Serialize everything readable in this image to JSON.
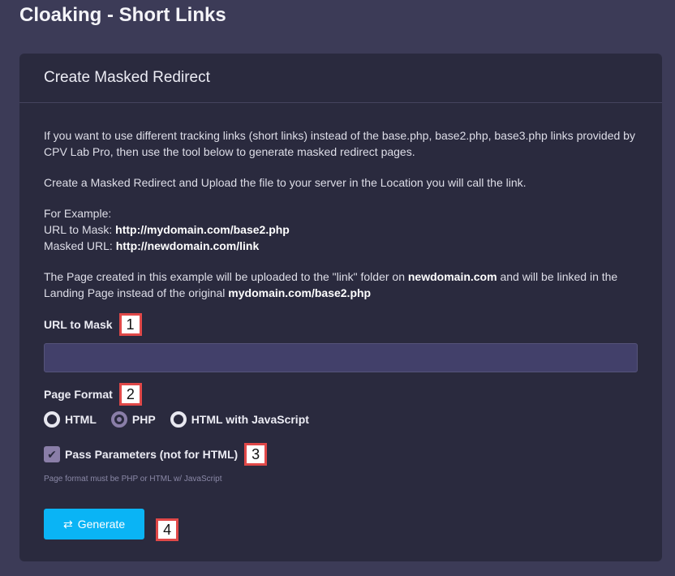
{
  "page": {
    "title": "Cloaking - Short Links"
  },
  "card": {
    "header": "Create Masked Redirect",
    "intro_part1": "If you want to use different tracking links (short links) instead of the base.php, base2.php, base3.php links provided by CPV Lab Pro, then use the tool below to generate masked redirect pages.",
    "intro_part2": "Create a Masked Redirect and Upload the file to your server in the Location you will call the link.",
    "example_heading": "For Example:",
    "example_url_label": "URL to Mask: ",
    "example_url_value": "http://mydomain.com/base2.php",
    "example_masked_label": "Masked URL: ",
    "example_masked_value": "http://newdomain.com/link",
    "explain_1": "The Page created in this example will be uploaded to the \"link\" folder on ",
    "explain_domain": "newdomain.com",
    "explain_2": " and will be linked in the Landing Page instead of the original ",
    "explain_original": "mydomain.com/base2.php"
  },
  "form": {
    "url_label": "URL to Mask",
    "url_value": "",
    "url_placeholder": "",
    "page_format_label": "Page Format",
    "formats": [
      "HTML",
      "PHP",
      "HTML with JavaScript"
    ],
    "selected_format": "PHP",
    "pass_params_label": "Pass Parameters (not for HTML)",
    "pass_params_checked": true,
    "help_text": "Page format must be PHP or HTML w/ JavaScript",
    "generate_label": "Generate"
  },
  "badges": [
    "1",
    "2",
    "3",
    "4"
  ],
  "colors": {
    "background": "#3c3b57",
    "card": "#2a2a3e",
    "accent": "#0ab4f5",
    "radio_selected": "#8a7ea8",
    "badge_border": "#e04848"
  },
  "icons": {
    "generate": "refresh-icon",
    "checkbox": "checkmark-icon"
  }
}
